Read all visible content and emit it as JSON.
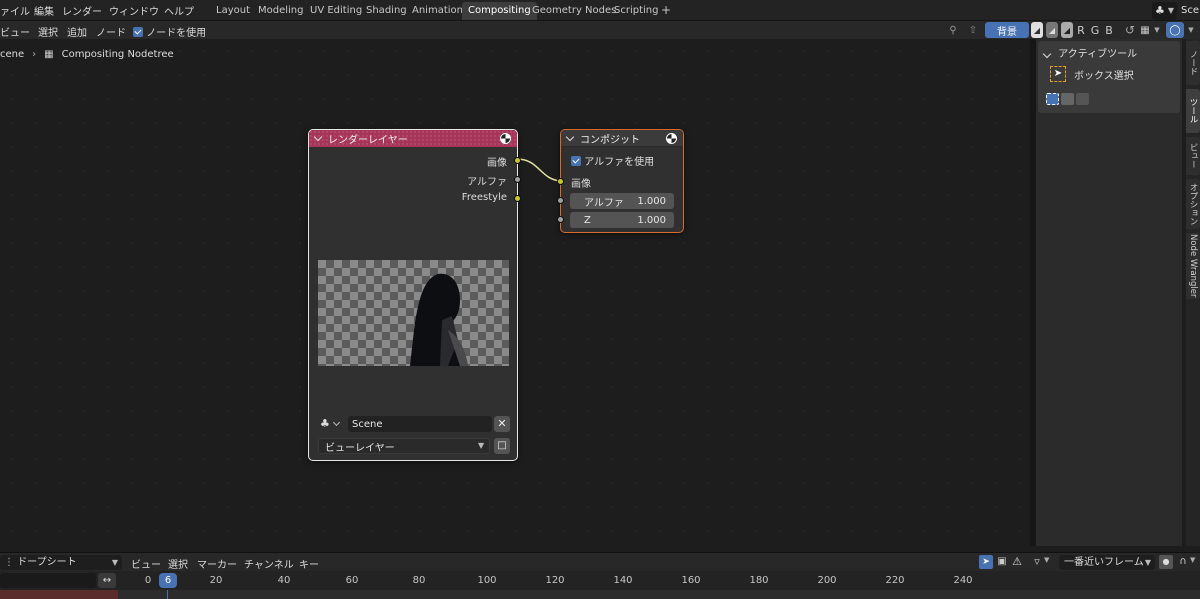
{
  "topbar": {
    "menus": [
      "ァイル",
      "編集",
      "レンダー",
      "ウィンドウ",
      "ヘルプ"
    ],
    "workspaces": [
      "Layout",
      "Modeling",
      "UV Editing",
      "Shading",
      "Animation",
      "Compositing",
      "Geometry Nodes",
      "Scripting",
      "+"
    ],
    "active_workspace": "Compositing",
    "scene_label": "Sce"
  },
  "node_header": {
    "menus": [
      "ビュー",
      "選択",
      "追加",
      "ノード"
    ],
    "use_nodes_label": "ノードを使用",
    "backdrop_label": "背景",
    "channels": [
      "R",
      "G",
      "B"
    ]
  },
  "breadcrumb": {
    "scene": "cene",
    "tree": "Compositing Nodetree"
  },
  "render_layers_node": {
    "title": "レンダーレイヤー",
    "outputs": [
      "画像",
      "アルファ",
      "Freestyle"
    ],
    "scene_value": "Scene",
    "view_layer_value": "ビューレイヤー"
  },
  "composite_node": {
    "title": "コンポジット",
    "use_alpha_label": "アルファを使用",
    "image_input": "画像",
    "alpha_field": {
      "label": "アルファ",
      "value": "1.000"
    },
    "z_field": {
      "label": "Z",
      "value": "1.000"
    }
  },
  "sidebar": {
    "panel_title": "アクティブツール",
    "tool_name": "ボックス選択",
    "tabs": [
      "ノード",
      "ツール",
      "ビュー",
      "オプション",
      "Node Wrangler"
    ]
  },
  "dopesheet": {
    "mode": "ドープシート",
    "menus": [
      "ビュー",
      "選択",
      "マーカー",
      "チャンネル",
      "キー"
    ],
    "snap_mode": "一番近いフレーム",
    "current_frame": "6",
    "ticks": [
      "0",
      "20",
      "40",
      "60",
      "80",
      "100",
      "120",
      "140",
      "160",
      "180",
      "200",
      "220",
      "240"
    ]
  },
  "colors": {
    "accent": "#4772b3",
    "render_layer_header": "#a63559",
    "composite_header": "#3b3b3b",
    "composite_outline": "#d86a30",
    "socket_yellow": "#c7c729"
  }
}
